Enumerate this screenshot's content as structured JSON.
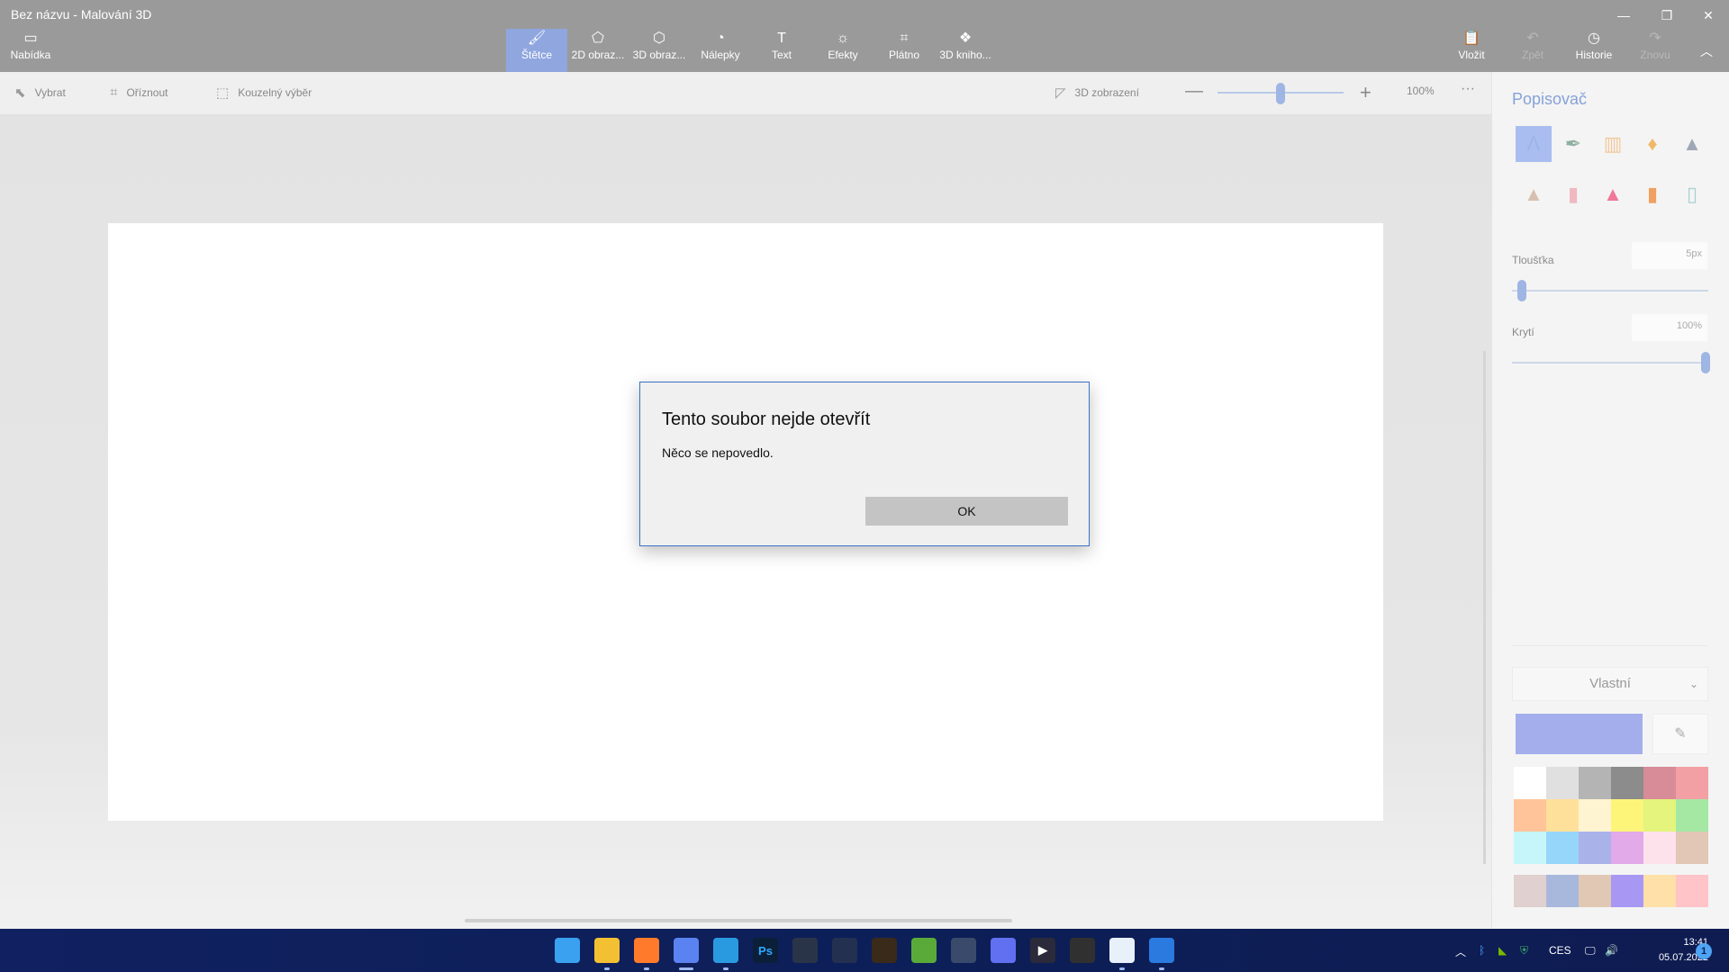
{
  "window": {
    "title": "Bez názvu - Malování 3D",
    "controls": [
      "minimize-icon",
      "restore-icon",
      "close-icon"
    ]
  },
  "ribbon": {
    "menu_label": "Nabídka",
    "tabs": [
      {
        "label": "Štětce",
        "icon": "brush-icon",
        "active": true
      },
      {
        "label": "2D obraz...",
        "icon": "2d-shapes-icon"
      },
      {
        "label": "3D obraz...",
        "icon": "3d-shapes-icon"
      },
      {
        "label": "Nálepky",
        "icon": "sticker-icon"
      },
      {
        "label": "Text",
        "icon": "text-icon"
      },
      {
        "label": "Efekty",
        "icon": "effects-icon"
      },
      {
        "label": "Plátno",
        "icon": "canvas-icon"
      },
      {
        "label": "3D kniho...",
        "icon": "3d-library-icon"
      }
    ],
    "right": [
      {
        "label": "Vložit",
        "icon": "paste-icon",
        "enabled": true
      },
      {
        "label": "Zpět",
        "icon": "undo-icon",
        "enabled": false
      },
      {
        "label": "Historie",
        "icon": "history-icon",
        "enabled": true
      },
      {
        "label": "Znovu",
        "icon": "redo-icon",
        "enabled": false
      }
    ]
  },
  "toolbar": {
    "select_label": "Vybrat",
    "crop_label": "Oříznout",
    "magic_select_label": "Kouzelný výběr",
    "view3d_label": "3D zobrazení",
    "zoom_value": "100%",
    "zoom_level": 0.5
  },
  "dialog": {
    "title": "Tento soubor nejde otevřít",
    "message": "Něco se nepovedlo.",
    "ok_label": "OK"
  },
  "panel": {
    "title": "Popisovač",
    "brushes": [
      "marker",
      "calligraphy-pen",
      "oil-brush",
      "watercolor",
      "pixel-pen",
      "pencil",
      "eraser",
      "crayon",
      "spray-can",
      "fill-bucket"
    ],
    "thickness_label": "Tloušťka",
    "thickness_value": "5px",
    "thickness_level": 0.05,
    "opacity_label": "Krytí",
    "opacity_value": "100%",
    "opacity_level": 1.0,
    "color_mode": "Vlastní",
    "current_color": "#a4aeec",
    "palette": [
      "#ffffff",
      "#e0e0e0",
      "#b4b4b4",
      "#8c8c8c",
      "#d88c98",
      "#f2a0a4",
      "#ffc49a",
      "#ffe09a",
      "#fff4d2",
      "#fdf57a",
      "#e4f47c",
      "#a4e8a4",
      "#c6f6fa",
      "#96d6fa",
      "#aab2ea",
      "#e2aae8",
      "#fde2ec",
      "#e2c6b6"
    ],
    "custom_palette": [
      "#e0d0d0",
      "#a8b8dc",
      "#e0c8b4",
      "#a898f4",
      "#ffe0a8",
      "#ffc4c8"
    ]
  },
  "taskbar": {
    "apps": [
      {
        "name": "start-icon",
        "color": "#3aa0f0",
        "glyph": ""
      },
      {
        "name": "file-explorer-icon",
        "color": "#f3c033",
        "glyph": ""
      },
      {
        "name": "firefox-icon",
        "color": "#ff7a2b",
        "glyph": ""
      },
      {
        "name": "paint-3d-icon",
        "color": "#5a82f0",
        "glyph": ""
      },
      {
        "name": "remote-app-icon",
        "color": "#2a9ae0",
        "glyph": ""
      },
      {
        "name": "photoshop-icon",
        "color": "#0b2038",
        "glyph": "Ps"
      },
      {
        "name": "davinci-resolve-icon",
        "color": "#2a3448",
        "glyph": ""
      },
      {
        "name": "warships-icon",
        "color": "#243050",
        "glyph": ""
      },
      {
        "name": "game-block-icon",
        "color": "#3a2a1a",
        "glyph": ""
      },
      {
        "name": "minecraft-icon",
        "color": "#5aaa3a",
        "glyph": ""
      },
      {
        "name": "arch-app-icon",
        "color": "#3a4a6a",
        "glyph": ""
      },
      {
        "name": "discord-icon",
        "color": "#6070f0",
        "glyph": ""
      },
      {
        "name": "media-player-icon",
        "color": "#2a2a3a",
        "glyph": "▶"
      },
      {
        "name": "obs-icon",
        "color": "#303030",
        "glyph": ""
      },
      {
        "name": "store-icon",
        "color": "#e8f0fa",
        "glyph": ""
      },
      {
        "name": "remote-desktop-icon",
        "color": "#2a7ae0",
        "glyph": ""
      }
    ],
    "tray": {
      "language": "CES",
      "time": "13:41",
      "date": "05.07.2022",
      "notifications": "1"
    }
  }
}
